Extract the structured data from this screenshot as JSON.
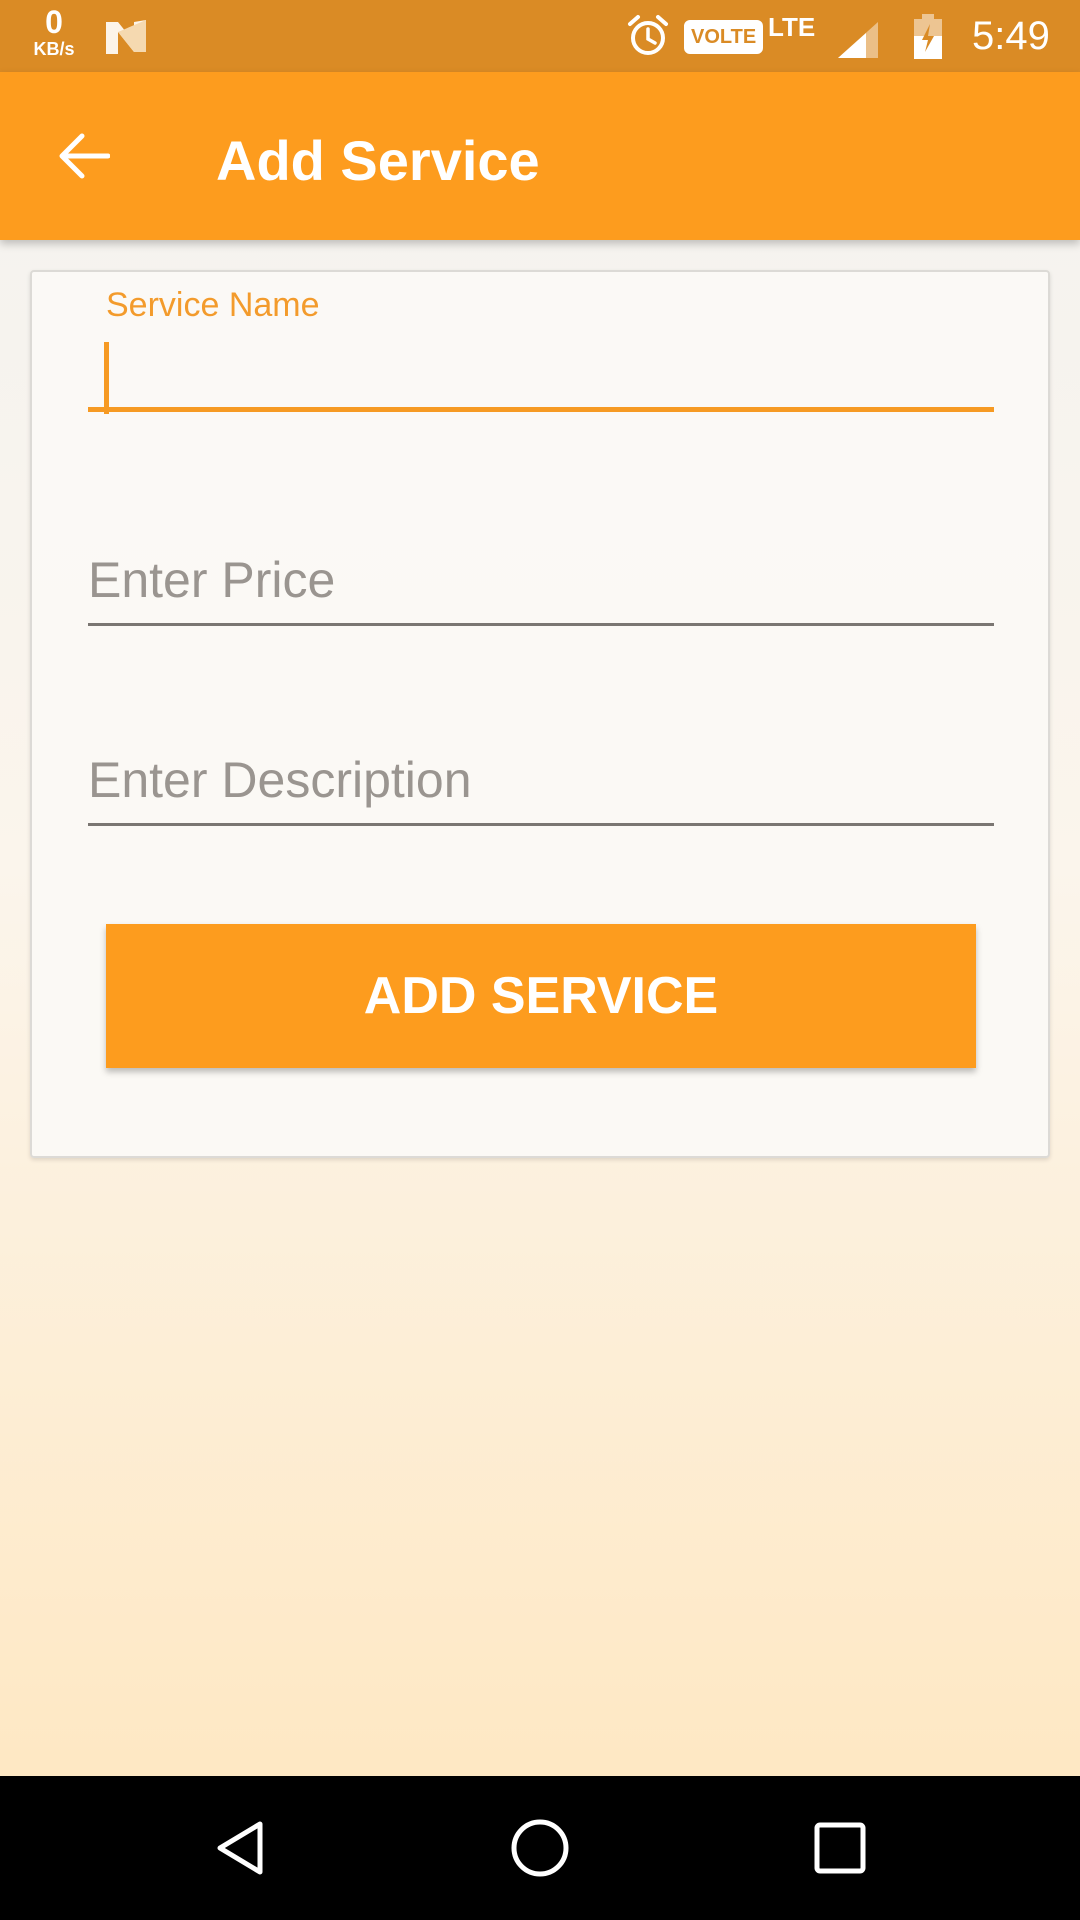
{
  "status_bar": {
    "net_speed_value": "0",
    "net_speed_unit": "KB/s",
    "volte_label": "VOLTE",
    "network_type": "LTE",
    "time": "5:49",
    "icons": [
      "notification-n-icon",
      "alarm-icon",
      "signal-icon",
      "battery-charging-icon"
    ]
  },
  "app_bar": {
    "title": "Add Service",
    "back_icon": "arrow-back-icon",
    "color": "#fd9c1e"
  },
  "form": {
    "service_name": {
      "label": "Service Name",
      "value": ""
    },
    "price": {
      "placeholder": "Enter Price",
      "value": ""
    },
    "description": {
      "placeholder": "Enter Description",
      "value": ""
    },
    "submit_label": "ADD SERVICE"
  },
  "nav_bar": {
    "icons": [
      "nav-back-icon",
      "nav-home-icon",
      "nav-recents-icon"
    ]
  },
  "colors": {
    "accent": "#fd9c1e",
    "status_bar": "#da8b25",
    "focused_field": "#f69a23"
  }
}
